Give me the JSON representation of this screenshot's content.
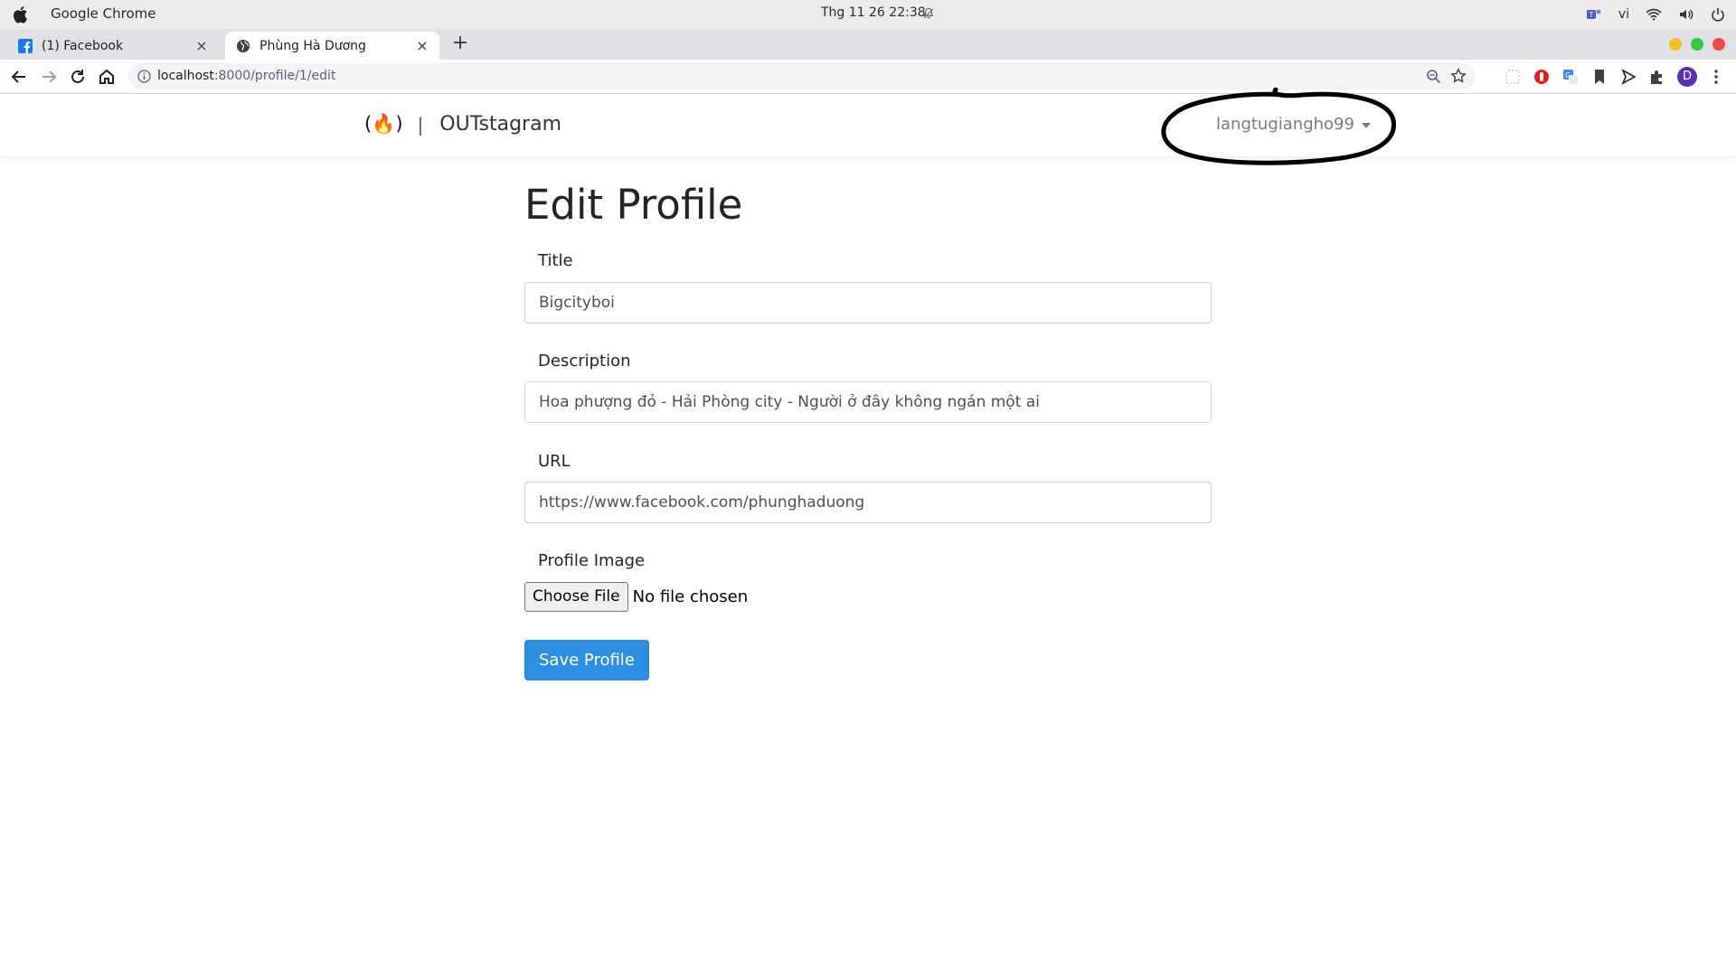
{
  "os": {
    "app_name": "Google Chrome",
    "clock": "Thg 11 26  22:38",
    "input_lang": "vi"
  },
  "browser": {
    "tabs": [
      {
        "title": "(1) Facebook",
        "active": false,
        "favicon": "facebook-icon"
      },
      {
        "title": "Phùng Hà Dương",
        "active": true,
        "favicon": "globe-icon"
      }
    ],
    "url_host": "localhost",
    "url_path": ":8000/profile/1/edit",
    "profile_initial": "D"
  },
  "navbar": {
    "logo": "(🔥)",
    "separator": "|",
    "brand": "OUTstagram",
    "username": "langtugiangho99"
  },
  "form": {
    "heading": "Edit Profile",
    "title_label": "Title",
    "title_value": "Bigcityboi",
    "description_label": "Description",
    "description_value": "Hoa phượng đỏ - Hải Phòng city - Người ở đây không ngán một ai",
    "url_label": "URL",
    "url_value": "https://www.facebook.com/phunghaduong",
    "image_label": "Profile Image",
    "file_button": "Choose File",
    "file_status": "No file chosen",
    "submit_label": "Save Profile"
  },
  "colors": {
    "primary_button": "#2e8fe0",
    "window_close": "#ed4a4a",
    "window_min": "#f5c026",
    "window_max": "#39c648"
  }
}
